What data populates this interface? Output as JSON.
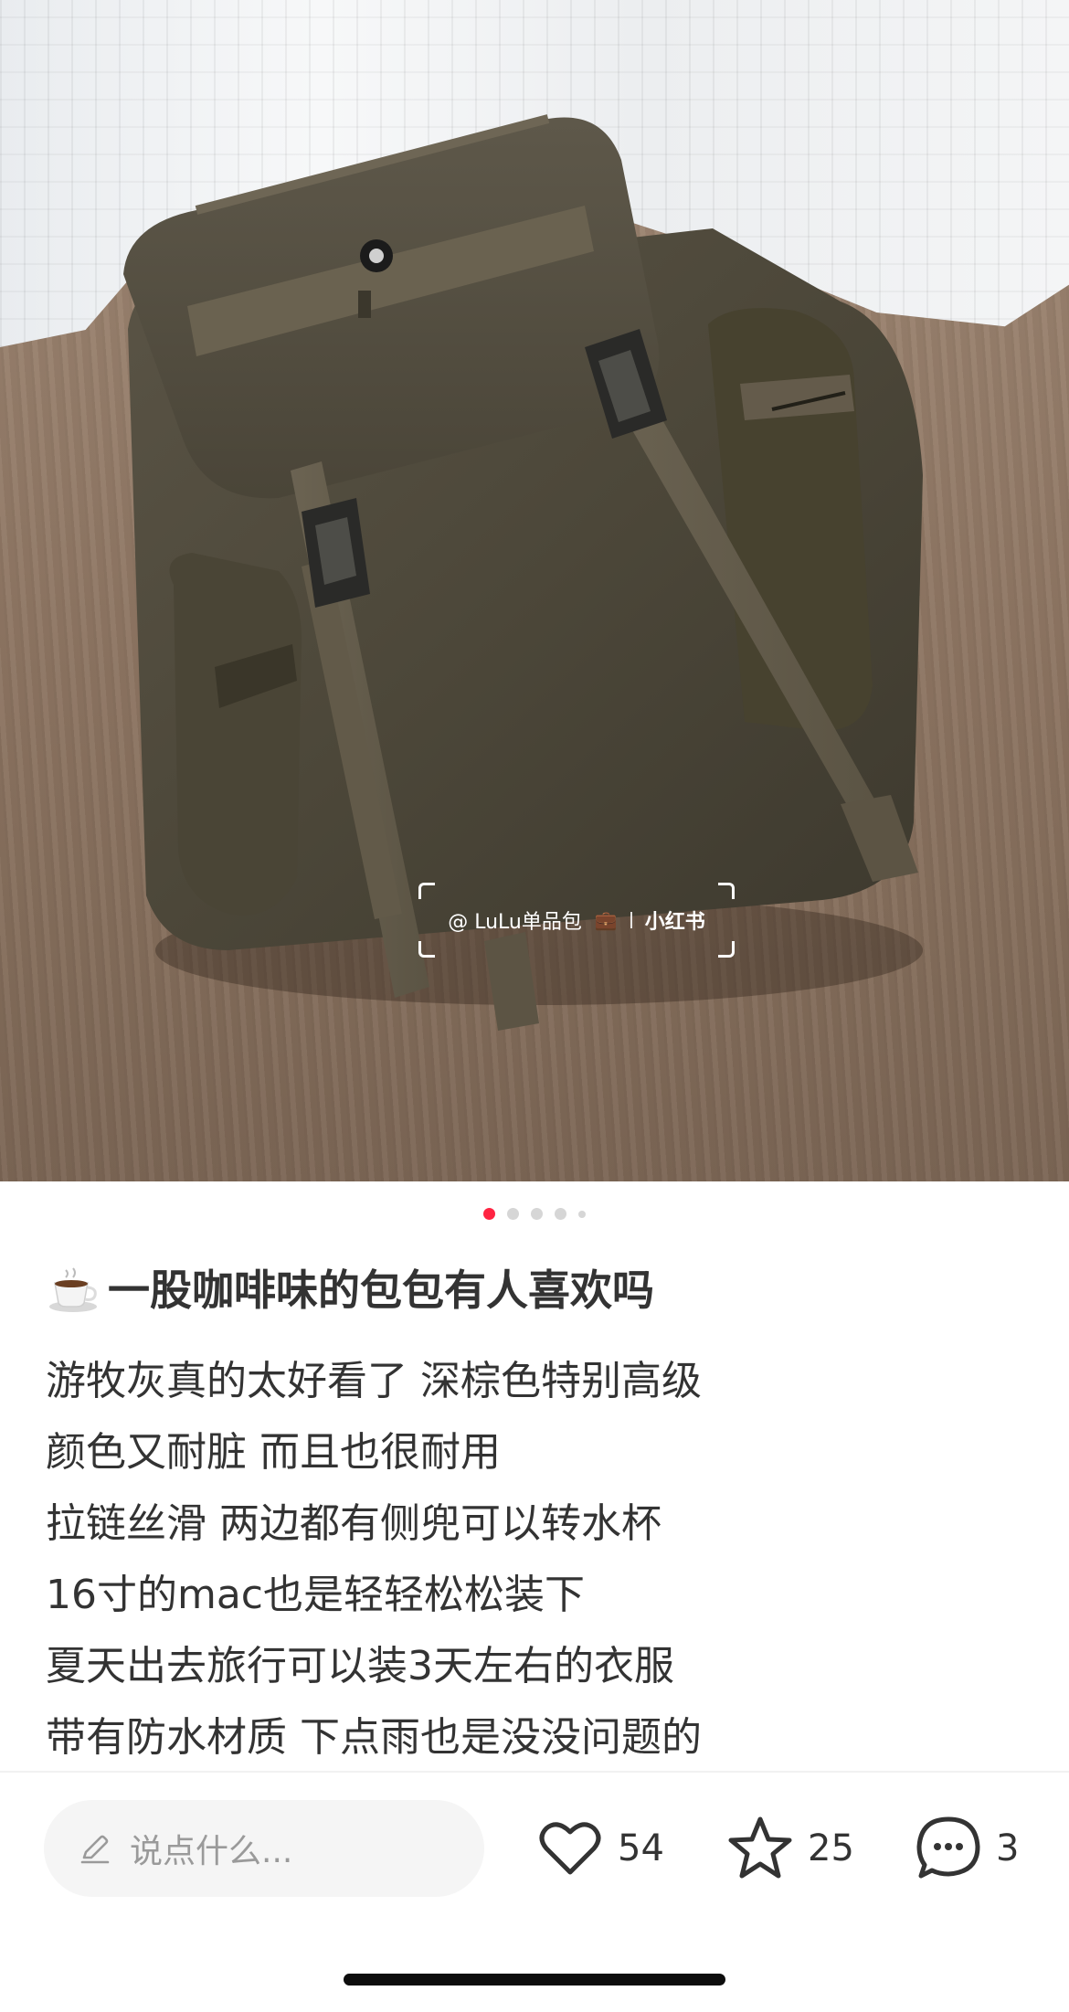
{
  "photo": {
    "watermark_user": "@ LuLu单品包",
    "watermark_brand": "小红书"
  },
  "carousel": {
    "total_dots": 5,
    "active_index": 0,
    "accent": "#ff2442"
  },
  "post": {
    "title_icon": "coffee-cup-icon",
    "title": "一股咖啡味的包包有人喜欢吗",
    "lines": [
      "游牧灰真的太好看了 深棕色特别高级",
      "颜色又耐脏 而且也很耐用",
      "拉链丝滑 两边都有侧兜可以转水杯",
      "16寸的mac也是轻轻松松装下",
      "夏天出去旅行可以装3天左右的衣服",
      "带有防水材质 下点雨也是没没问题的"
    ]
  },
  "bottom_bar": {
    "comment_placeholder": "说点什么...",
    "like_count": "54",
    "collect_count": "25",
    "comment_count": "3"
  }
}
